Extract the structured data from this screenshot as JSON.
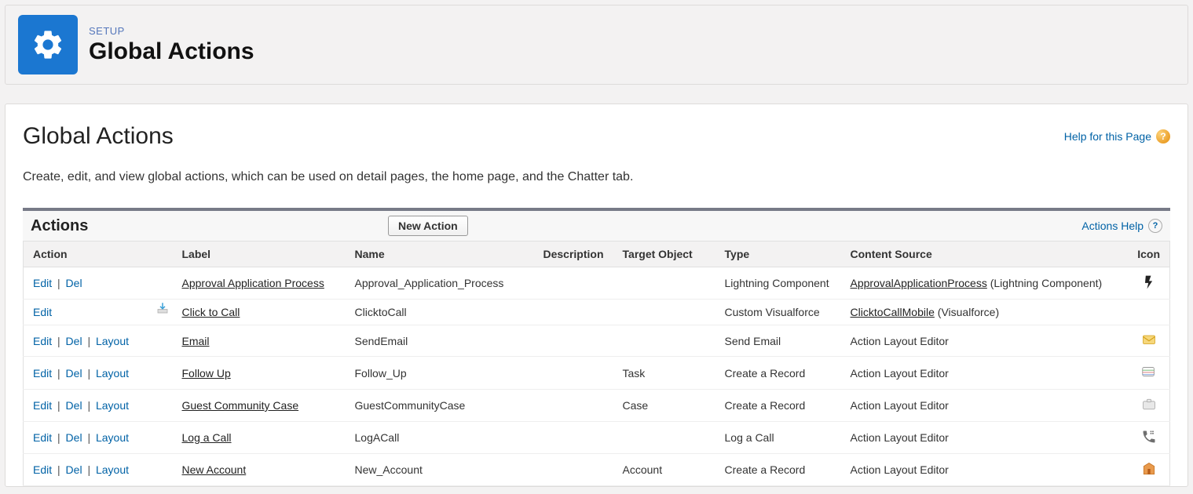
{
  "header": {
    "setup_label": "SETUP",
    "title": "Global Actions"
  },
  "page": {
    "title": "Global Actions",
    "help_link": "Help for this Page",
    "description": "Create, edit, and view global actions, which can be used on detail pages, the home page, and the Chatter tab."
  },
  "table_header": {
    "actions_label": "Actions",
    "new_action_btn": "New Action",
    "actions_help": "Actions Help"
  },
  "columns": {
    "action": "Action",
    "label": "Label",
    "name": "Name",
    "description": "Description",
    "target_object": "Target Object",
    "type": "Type",
    "content_source": "Content Source",
    "icon": "Icon"
  },
  "action_labels": {
    "edit": "Edit",
    "del": "Del",
    "layout": "Layout"
  },
  "rows": [
    {
      "actions": [
        "edit",
        "del"
      ],
      "label": "Approval Application Process",
      "name": "Approval_Application_Process",
      "description": "",
      "target_object": "",
      "type": "Lightning Component",
      "content_source_link": "ApprovalApplicationProcess",
      "content_source_suffix": " (Lightning Component)",
      "content_source_plain": "",
      "icon": "lightning"
    },
    {
      "actions": [
        "edit"
      ],
      "has_download_icon": true,
      "label": "Click to Call",
      "name": "ClicktoCall",
      "description": "",
      "target_object": "",
      "type": "Custom Visualforce",
      "content_source_link": "ClicktoCallMobile",
      "content_source_suffix": " (Visualforce)",
      "content_source_plain": "",
      "icon": ""
    },
    {
      "actions": [
        "edit",
        "del",
        "layout"
      ],
      "label": "Email",
      "name": "SendEmail",
      "description": "",
      "target_object": "",
      "type": "Send Email",
      "content_source_link": "",
      "content_source_suffix": "",
      "content_source_plain": "Action Layout Editor",
      "icon": "email"
    },
    {
      "actions": [
        "edit",
        "del",
        "layout"
      ],
      "label": "Follow Up",
      "name": "Follow_Up",
      "description": "",
      "target_object": "Task",
      "type": "Create a Record",
      "content_source_link": "",
      "content_source_suffix": "",
      "content_source_plain": "Action Layout Editor",
      "icon": "followup"
    },
    {
      "actions": [
        "edit",
        "del",
        "layout"
      ],
      "label": "Guest Community Case",
      "name": "GuestCommunityCase",
      "description": "",
      "target_object": "Case",
      "type": "Create a Record",
      "content_source_link": "",
      "content_source_suffix": "",
      "content_source_plain": "Action Layout Editor",
      "icon": "case"
    },
    {
      "actions": [
        "edit",
        "del",
        "layout"
      ],
      "label": "Log a Call",
      "name": "LogACall",
      "description": "",
      "target_object": "",
      "type": "Log a Call",
      "content_source_link": "",
      "content_source_suffix": "",
      "content_source_plain": "Action Layout Editor",
      "icon": "call"
    },
    {
      "actions": [
        "edit",
        "del",
        "layout"
      ],
      "label": "New Account",
      "name": "New_Account",
      "description": "",
      "target_object": "Account",
      "type": "Create a Record",
      "content_source_link": "",
      "content_source_suffix": "",
      "content_source_plain": "Action Layout Editor",
      "icon": "account"
    }
  ]
}
